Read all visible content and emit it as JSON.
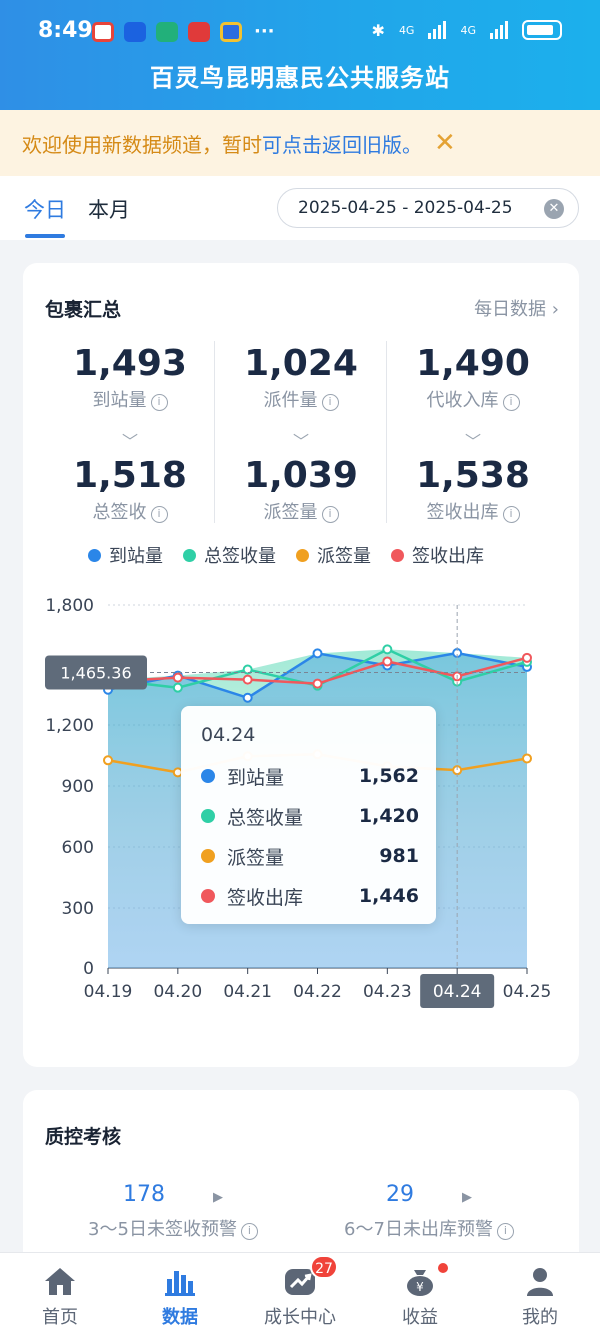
{
  "status": {
    "time": "8:49",
    "net1": "4G",
    "net2": "4G"
  },
  "app_title": "百灵鸟昆明惠民公共服务站",
  "notice": {
    "text1": "欢迎使用新数据频道，暂时",
    "text2": "可点击返回旧版。",
    "close": "✕"
  },
  "tabs": [
    {
      "label": "今日",
      "active": true
    },
    {
      "label": "本月",
      "active": false
    }
  ],
  "date_range": "2025-04-25 - 2025-04-25",
  "package_summary": {
    "title": "包裹汇总",
    "daily_link": "每日数据",
    "stats": [
      {
        "value": "1,493",
        "label": "到站量"
      },
      {
        "value": "1,024",
        "label": "派件量"
      },
      {
        "value": "1,490",
        "label": "代收入库"
      },
      {
        "value": "1,518",
        "label": "总签收"
      },
      {
        "value": "1,039",
        "label": "派签量"
      },
      {
        "value": "1,538",
        "label": "签收出库"
      }
    ]
  },
  "chart_data": {
    "type": "line",
    "categories": [
      "04.19",
      "04.20",
      "04.21",
      "04.22",
      "04.23",
      "04.24",
      "04.25"
    ],
    "series": [
      {
        "name": "到站量",
        "color": "#2b86e8",
        "values": [
          1380,
          1450,
          1340,
          1560,
          1500,
          1562,
          1493
        ]
      },
      {
        "name": "总签收量",
        "color": "#2fcfa6",
        "values": [
          1430,
          1390,
          1480,
          1400,
          1580,
          1420,
          1518
        ]
      },
      {
        "name": "派签量",
        "color": "#f0a020",
        "values": [
          1030,
          970,
          1050,
          1060,
          1000,
          981,
          1039
        ]
      },
      {
        "name": "签收出库",
        "color": "#f0585c",
        "values": [
          1420,
          1440,
          1430,
          1410,
          1520,
          1446,
          1538
        ]
      }
    ],
    "yticks": [
      "0",
      "300",
      "600",
      "900",
      "1,200",
      "1,800"
    ],
    "ylim": [
      0,
      1800
    ],
    "reference_line": 1465.36,
    "reference_label": "1,465.36",
    "highlight": "04.24",
    "tooltip": {
      "date": "04.24",
      "rows": [
        {
          "name": "到站量",
          "value": "1,562",
          "color": "#2b86e8"
        },
        {
          "name": "总签收量",
          "value": "1,420",
          "color": "#2fcfa6"
        },
        {
          "name": "派签量",
          "value": "981",
          "color": "#f0a020"
        },
        {
          "name": "签收出库",
          "value": "1,446",
          "color": "#f0585c"
        }
      ]
    }
  },
  "quality": {
    "title": "质控考核",
    "items": [
      {
        "value": "178",
        "label": "3～5日未签收预警"
      },
      {
        "value": "29",
        "label": "6～7日未出库预警"
      }
    ]
  },
  "nav": [
    {
      "label": "首页",
      "icon": "home-icon"
    },
    {
      "label": "数据",
      "icon": "bar-chart-icon",
      "active": true
    },
    {
      "label": "成长中心",
      "icon": "growth-icon",
      "badge": "27"
    },
    {
      "label": "收益",
      "icon": "money-bag-icon",
      "dot": true
    },
    {
      "label": "我的",
      "icon": "user-icon"
    }
  ]
}
